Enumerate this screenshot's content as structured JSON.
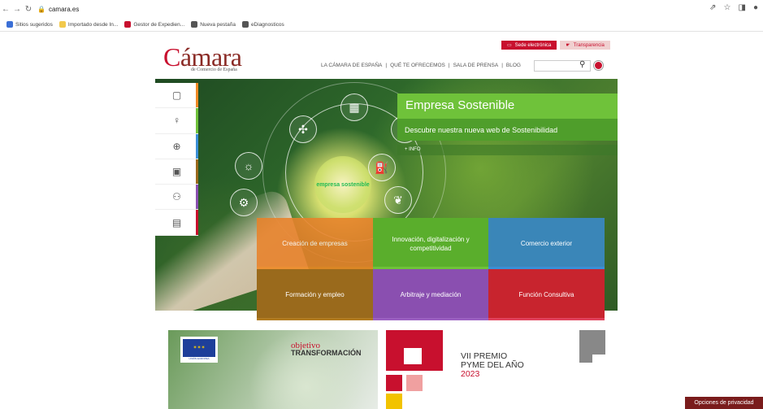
{
  "browser": {
    "url": "camara.es"
  },
  "bookmarks": [
    {
      "label": "Sitios sugeridos",
      "color": "#3b6fd6"
    },
    {
      "label": "Importado desde In...",
      "color": "#f2c94c"
    },
    {
      "label": "Gestor de Expedien...",
      "color": "#c8102e"
    },
    {
      "label": "Nueva pestaña",
      "color": "#555555"
    },
    {
      "label": "eDiagnosticos",
      "color": "#555555"
    }
  ],
  "site": {
    "logo_main": "ámara",
    "logo_initial": "C",
    "logo_sub": "de Comercio de España",
    "sede": "Sede electrónica",
    "transparencia": "Transparencia",
    "nav": [
      "LA CÁMARA DE ESPAÑA",
      "|",
      "QUÉ TE OFRECEMOS",
      "|",
      "SALA DE PRENSA",
      "|",
      "BLOG"
    ]
  },
  "side_menu": [
    {
      "icon": "briefcase-icon",
      "glyph": "▢",
      "color": "#f08a24"
    },
    {
      "icon": "lightbulb-icon",
      "glyph": "♀",
      "color": "#6fc23a"
    },
    {
      "icon": "globe-icon",
      "glyph": "⊕",
      "color": "#3a8fd6"
    },
    {
      "icon": "certificate-icon",
      "glyph": "▣",
      "color": "#9a6a1c"
    },
    {
      "icon": "people-icon",
      "glyph": "⚇",
      "color": "#8a4fb0"
    },
    {
      "icon": "document-icon",
      "glyph": "▤",
      "color": "#c8102e"
    }
  ],
  "hero": {
    "title": "Empresa Sostenible",
    "subtitle": "Descubre nuestra nueva web de Sostenibilidad",
    "info": "+ INFO",
    "bulb_text": "empresa sostenible"
  },
  "tiles": [
    {
      "label": "Creación de empresas",
      "bg": "#e9822a",
      "stripe": "#f08a24"
    },
    {
      "label": "Innovación, digitalización y competitividad",
      "bg": "#5aae2c",
      "stripe": "#6fc23a"
    },
    {
      "label": "Comercio exterior",
      "bg": "#3a86b8",
      "stripe": "#3a8fd6"
    },
    {
      "label": "Formación y empleo",
      "bg": "#9a6a1c",
      "stripe": "#b07a20"
    },
    {
      "label": "Arbitraje y mediación",
      "bg": "#8a4fb0",
      "stripe": "#9a5fc0"
    },
    {
      "label": "Función Consultiva",
      "bg": "#c8242e",
      "stripe": "#e0405a"
    }
  ],
  "promo": {
    "eu_label": "UNIÓN EUROPEA",
    "objetivo": "objetivo",
    "transformacion": "TRANSFORMACIÓN",
    "premio_l1": "VII PREMIO",
    "premio_l2": "PYME DEL AÑO",
    "premio_year": "2023"
  },
  "privacy": "Opciones de privacidad"
}
